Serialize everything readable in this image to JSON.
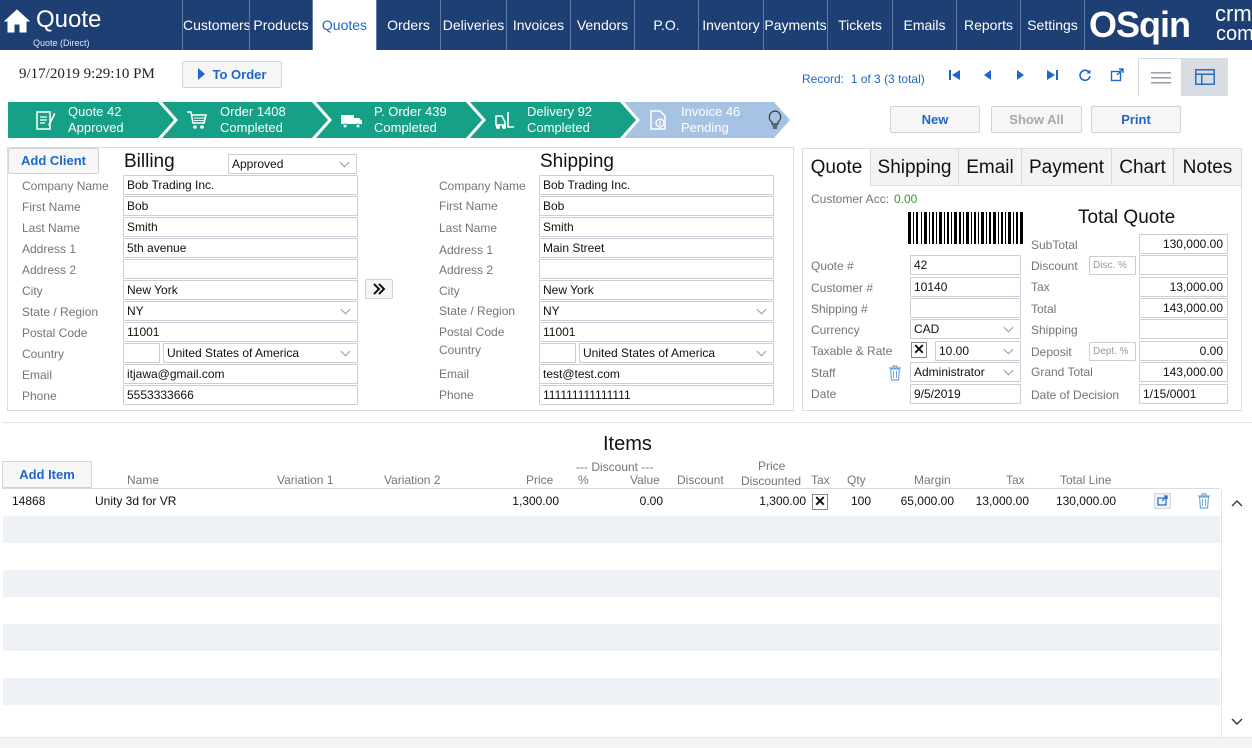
{
  "app": {
    "title": "Quote",
    "subtitle": "Quote (Direct)"
  },
  "nav": [
    "Customers",
    "Products",
    "Quotes",
    "Orders",
    "Deliveries",
    "Invoices",
    "Vendors",
    "P.O.",
    "Inventory",
    "Payments",
    "Tickets",
    "Emails",
    "Reports",
    "Settings"
  ],
  "nav_active": "Quotes",
  "logo": {
    "main": "OSqin",
    "top": "crm",
    "bottom": "com"
  },
  "toolbar": {
    "datetime": "9/17/2019 9:29:10 PM",
    "to_order": "To Order",
    "record_label": "Record:",
    "record_value": "1 of 3 (3 total)"
  },
  "workflow": [
    {
      "title": "Quote 42",
      "status": "Approved",
      "icon": "quote-icon"
    },
    {
      "title": "Order 1408",
      "status": "Completed",
      "icon": "cart-icon"
    },
    {
      "title": "P. Order 439",
      "status": "Completed",
      "icon": "truck-icon"
    },
    {
      "title": "Delivery 92",
      "status": "Completed",
      "icon": "forklift-icon"
    },
    {
      "title": "Invoice 46",
      "status": "Pending",
      "icon": "invoice-icon"
    }
  ],
  "actions": {
    "new": "New",
    "show_all": "Show All",
    "print": "Print"
  },
  "billing": {
    "add_client": "Add Client",
    "title": "Billing",
    "status": "Approved",
    "labels": [
      "Company Name",
      "First Name",
      "Last Name",
      "Address 1",
      "Address 2",
      "City",
      "State / Region",
      "Postal Code",
      "Country",
      "Email",
      "Phone"
    ],
    "company": "Bob Trading Inc.",
    "first_name": "Bob",
    "last_name": "Smith",
    "address1": "5th avenue",
    "address2": "",
    "city": "New York",
    "state": "NY",
    "postal": "11001",
    "country_code": "",
    "country": "United States of America",
    "email": "itjawa@gmail.com",
    "phone": "5553333666"
  },
  "shipping": {
    "title": "Shipping",
    "labels": [
      "Company Name",
      "First Name",
      "Last Name",
      "Address 1",
      "Address 2",
      "City",
      "State / Region",
      "Postal Code",
      "Country",
      "Email",
      "Phone"
    ],
    "company": "Bob Trading Inc.",
    "first_name": "Bob",
    "last_name": "Smith",
    "address1": "Main Street",
    "address2": "",
    "city": "New York",
    "state": "NY",
    "postal": "11001",
    "country_code": "",
    "country": "United States of America",
    "email": "test@test.com",
    "phone": "111111111111111"
  },
  "side_tabs": [
    "Quote",
    "Shipping",
    "Email",
    "Payment",
    "Chart",
    "Notes"
  ],
  "quote": {
    "customer_acc_label": "Customer Acc:",
    "customer_acc_value": "0.00",
    "labels": {
      "quote_no": "Quote #",
      "customer_no": "Customer #",
      "shipping_no": "Shipping #",
      "currency": "Currency",
      "taxable_rate": "Taxable & Rate",
      "staff": "Staff",
      "date": "Date"
    },
    "quote_no": "42",
    "customer_no": "10140",
    "shipping_no": "",
    "currency": "CAD",
    "taxable": "✕",
    "rate": "10.00",
    "staff": "Administrator",
    "date": "9/5/2019",
    "total_title": "Total Quote",
    "totals_labels": {
      "subtotal": "SubTotal",
      "discount": "Discount",
      "tax": "Tax",
      "total": "Total",
      "shipping": "Shipping",
      "deposit": "Deposit",
      "grand_total": "Grand Total",
      "date_of_decision": "Date of Decision"
    },
    "disc_placeholder": "Disc. %",
    "dept_placeholder": "Dept. %",
    "subtotal": "130,000.00",
    "discount": "",
    "tax": "13,000.00",
    "total": "143,000.00",
    "shipping": "",
    "deposit": "0.00",
    "grand_total": "143,000.00",
    "date_of_decision": "1/15/0001"
  },
  "items": {
    "title": "Items",
    "add_item": "Add Item",
    "columns": {
      "name": "Name",
      "variation1": "Variation 1",
      "variation2": "Variation 2",
      "price": "Price",
      "discount_group": "--- Discount ---",
      "pct": "%",
      "value": "Value",
      "discount": "Discount",
      "price_disc_1": "Price",
      "price_disc_2": "Discounted",
      "tax": "Tax",
      "qty": "Qty",
      "margin": "Margin",
      "tax2": "Tax",
      "total_line": "Total Line"
    },
    "rows": [
      {
        "id": "14868",
        "name": "Unity 3d for VR",
        "variation1": "",
        "variation2": "",
        "price": "1,300.00",
        "pct": "",
        "value": "0.00",
        "discount": "",
        "price_discounted": "1,300.00",
        "tax": "✕",
        "qty": "100",
        "margin": "65,000.00",
        "tax_amount": "13,000.00",
        "total_line": "130,000.00"
      }
    ]
  },
  "colors": {
    "navy": "#1e3f73",
    "green": "#16a085",
    "pending": "#a7c3e4",
    "link": "#1e66c8",
    "acc": "#2e9e2e"
  }
}
